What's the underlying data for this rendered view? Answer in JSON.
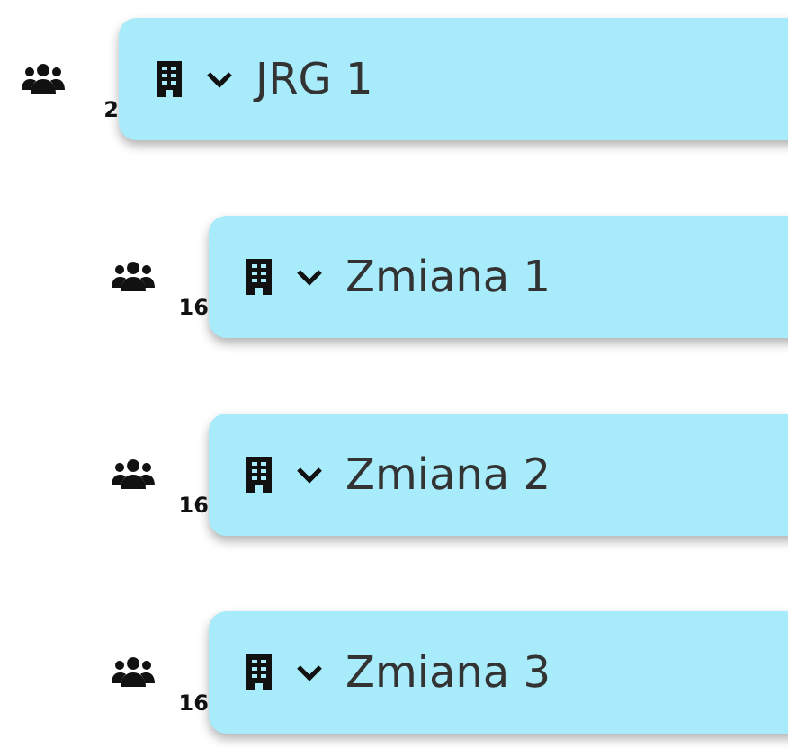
{
  "tree": [
    {
      "label": "JRG 1",
      "count": "2",
      "expanded": true,
      "children": [
        {
          "label": "Zmiana 1",
          "count": "16",
          "expanded": true
        },
        {
          "label": "Zmiana 2",
          "count": "16",
          "expanded": true
        },
        {
          "label": "Zmiana 3",
          "count": "16",
          "expanded": true
        }
      ]
    }
  ]
}
